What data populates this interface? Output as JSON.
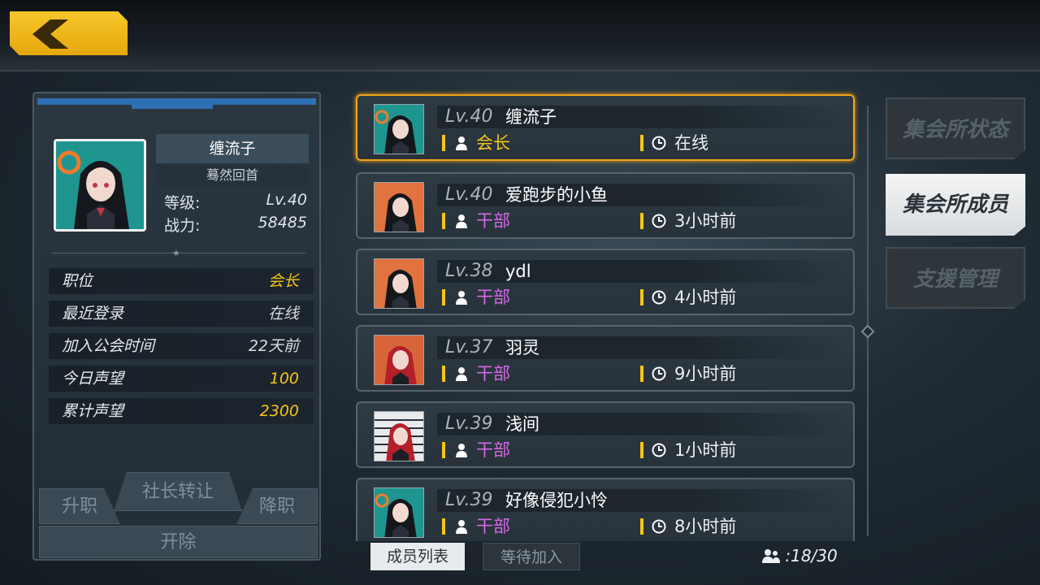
{
  "selected_member": {
    "name": "缠流子",
    "title": "蓦然回首",
    "level_label": "等级:",
    "level": "Lv.40",
    "power_label": "战力:",
    "power": "58485"
  },
  "info_rows": [
    {
      "key": "职位",
      "value": "会长",
      "color": "#f5c518"
    },
    {
      "key": "最近登录",
      "value": "在线",
      "color": "#d6dbdf"
    },
    {
      "key": "加入公会时间",
      "value": "22天前",
      "color": "#d6dbdf"
    },
    {
      "key": "今日声望",
      "value": "100",
      "color": "#f5c518"
    },
    {
      "key": "累计声望",
      "value": "2300",
      "color": "#f5c518"
    }
  ],
  "actions": {
    "promote": "升职",
    "transfer": "社长转让",
    "demote": "降职",
    "kick": "开除"
  },
  "members": [
    {
      "level": "Lv.40",
      "name": "缠流子",
      "role": "会长",
      "role_type": "leader",
      "time": "在线",
      "avatar": "teal"
    },
    {
      "level": "Lv.40",
      "name": "爱跑步的小鱼",
      "role": "干部",
      "role_type": "officer",
      "time": "3小时前",
      "avatar": "orange"
    },
    {
      "level": "Lv.38",
      "name": "ydl",
      "role": "干部",
      "role_type": "officer",
      "time": "4小时前",
      "avatar": "orange"
    },
    {
      "level": "Lv.37",
      "name": "羽灵",
      "role": "干部",
      "role_type": "officer",
      "time": "9小时前",
      "avatar": "orange-red"
    },
    {
      "level": "Lv.39",
      "name": "浅间",
      "role": "干部",
      "role_type": "officer",
      "time": "1小时前",
      "avatar": "barcode"
    },
    {
      "level": "Lv.39",
      "name": "好像侵犯小怜",
      "role": "干部",
      "role_type": "officer",
      "time": "8小时前",
      "avatar": "teal"
    }
  ],
  "list_tabs": {
    "members": "成员列表",
    "pending": "等待加入"
  },
  "member_count": ":18/30",
  "side_tabs": {
    "status": "集会所状态",
    "members": "集会所成员",
    "support": "支援管理"
  },
  "colors": {
    "accent_gold": "#f5c518",
    "officer_purple": "#d36ae6",
    "selected_border": "#f0a41a"
  }
}
